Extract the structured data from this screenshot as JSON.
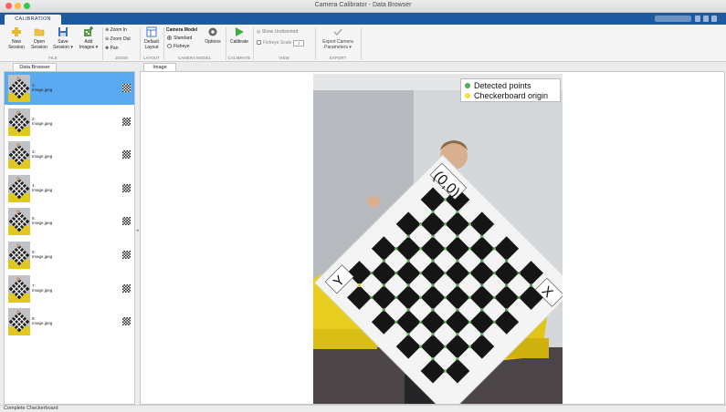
{
  "window": {
    "title": "Camera Calibrator - Data Browser"
  },
  "ribbon": {
    "tab": "CALIBRATION",
    "file": {
      "new_session": [
        "New",
        "Session"
      ],
      "open_session": [
        "Open",
        "Session"
      ],
      "save_session": [
        "Save",
        "Session ▾"
      ],
      "add_images": [
        "Add",
        "Images ▾"
      ],
      "label": "FILE"
    },
    "zoom": {
      "zoom_in": "Zoom In",
      "zoom_out": "Zoom Out",
      "pan": "Pan",
      "label": "ZOOM"
    },
    "layout": {
      "default_layout": [
        "Default",
        "Layout"
      ],
      "label": "LAYOUT"
    },
    "camera_model": {
      "heading": "Camera Model",
      "standard": "Standard",
      "fisheye": "Fisheye",
      "options": "Options",
      "label": "CAMERA MODEL"
    },
    "calibrate": {
      "button": "Calibrate",
      "label": "CALIBRATE"
    },
    "view": {
      "show_undistorted": "Show Undistorted",
      "fisheye_scale": "Fisheye Scale",
      "fisheye_scale_value": "1",
      "label": "VIEW"
    },
    "export": {
      "button": [
        "Export Camera",
        "Parameters ▾"
      ],
      "label": "EXPORT"
    }
  },
  "panels": {
    "data_browser": "Data Browser",
    "image": "Image"
  },
  "images": [
    {
      "index": "1:",
      "name": "Image.jpeg",
      "selected": true
    },
    {
      "index": "2:",
      "name": "Image.jpeg",
      "selected": false
    },
    {
      "index": "3:",
      "name": "Image.jpeg",
      "selected": false
    },
    {
      "index": "4:",
      "name": "Image.jpeg",
      "selected": false
    },
    {
      "index": "5:",
      "name": "Image.jpeg",
      "selected": false
    },
    {
      "index": "6:",
      "name": "Image.jpeg",
      "selected": false
    },
    {
      "index": "7:",
      "name": "Image.jpeg",
      "selected": false
    },
    {
      "index": "8:",
      "name": "Image.jpeg",
      "selected": false
    }
  ],
  "viewer": {
    "legend": [
      {
        "label": "Detected points",
        "color": "#4caf50"
      },
      {
        "label": "Checkerboard origin",
        "color": "#f2e23a"
      }
    ],
    "origin_label": "(0,0)",
    "x_axis_label": "X",
    "y_axis_label": "Y"
  },
  "status": "Complete Checkerboard",
  "colors": {
    "accent": "#1e5aa0",
    "selection": "#5aaaf2"
  }
}
